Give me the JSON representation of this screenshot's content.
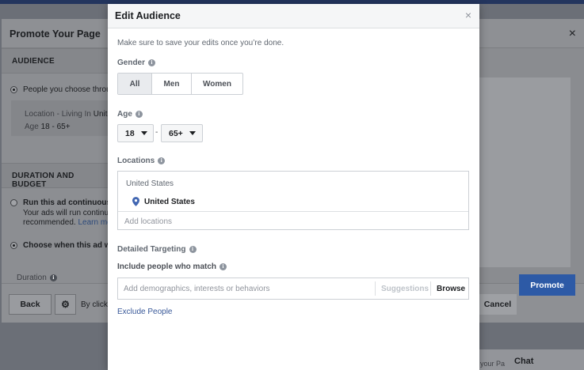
{
  "background": {
    "promote": {
      "title": "Promote Your Page",
      "close_label": "×",
      "audience_section": "AUDIENCE",
      "audience_option": "People you choose throu",
      "location_prefix": "Location - Living In ",
      "location_value": "Unite",
      "age_prefix": "Age ",
      "age_value": "18 - 65+",
      "duration_section": "DURATION AND BUDGET",
      "run_continuously": "Run this ad continuousl",
      "run_desc_1": "Your ads will run continu",
      "run_desc_2": "recommended. ",
      "learn_more": "Learn mo",
      "choose_when": "Choose when this ad wi",
      "duration_label": "Duration",
      "back_label": "Back",
      "by_click": "By click",
      "cancel_label": "Cancel",
      "promote_label": "Promote"
    },
    "chat_label": "Chat",
    "faded_text": "your Pa"
  },
  "edit_audience": {
    "title": "Edit Audience",
    "close_label": "×",
    "notice": "Make sure to save your edits once you’re done.",
    "gender": {
      "label": "Gender",
      "options": [
        "All",
        "Men",
        "Women"
      ],
      "selected": "All"
    },
    "age": {
      "label": "Age",
      "min": "18",
      "separator": "-",
      "max": "65+"
    },
    "locations": {
      "label": "Locations",
      "country": "United States",
      "selected_item": "United States",
      "placeholder": "Add locations"
    },
    "detailed_targeting": {
      "label": "Detailed Targeting",
      "include_label": "Include people who match",
      "placeholder": "Add demographics, interests or behaviors",
      "suggestions_label": "Suggestions",
      "browse_label": "Browse"
    },
    "exclude_link": "Exclude People"
  },
  "colors": {
    "accent": "#385898",
    "promote_button": "#2d5aa6",
    "pin": "#4267b2"
  }
}
